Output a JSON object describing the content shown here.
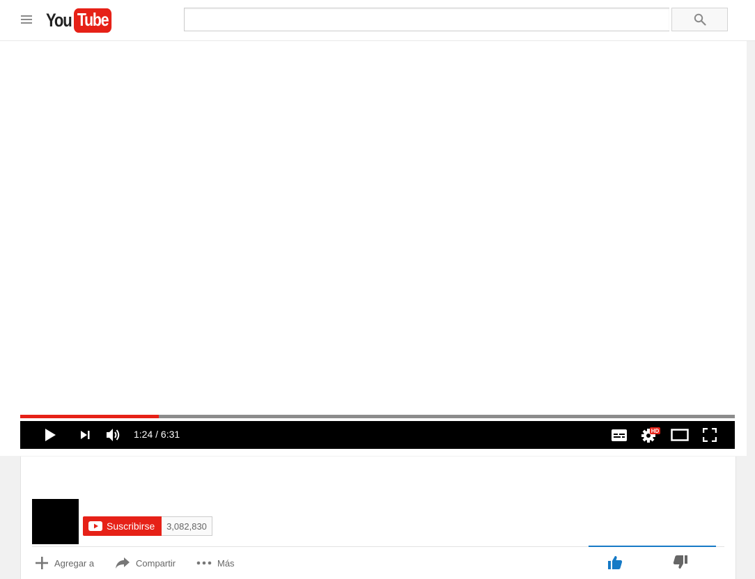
{
  "header": {
    "logo_you": "You",
    "logo_tube": "Tube",
    "search": {
      "placeholder": "",
      "value": ""
    }
  },
  "player": {
    "progress_fraction": 0.1942,
    "current_time": "1:24",
    "duration": "6:31",
    "time_display": "1:24 / 6:31",
    "hd_badge": "HD",
    "colors": {
      "progress_played": "#e62117",
      "progress_track": "#8c8c8c",
      "controls_bg": "#000000"
    }
  },
  "channel": {
    "subscribe_label": "Suscribirse",
    "subscriber_count": "3,082,830"
  },
  "actions": {
    "add_to_label": "Agregar a",
    "share_label": "Compartir",
    "more_label": "Más"
  },
  "icons": [
    "menu-icon",
    "search-icon",
    "play-icon",
    "next-icon",
    "volume-icon",
    "subtitles-icon",
    "settings-icon",
    "theater-mode-icon",
    "fullscreen-icon",
    "plus-icon",
    "share-icon",
    "more-icon",
    "like-icon",
    "dislike-icon"
  ],
  "colors": {
    "brand_red": "#e62117",
    "like_blue": "#167ac6"
  }
}
